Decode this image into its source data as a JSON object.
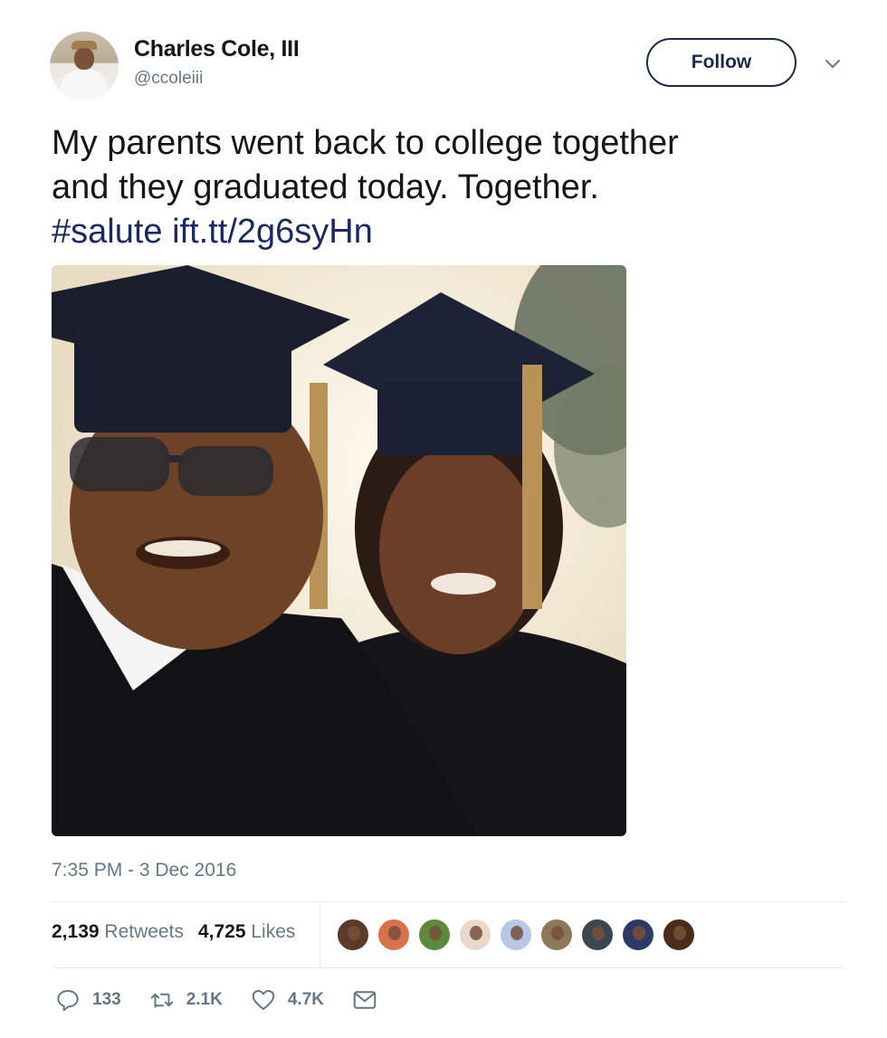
{
  "author": {
    "name": "Charles Cole, III",
    "handle": "@ccoleiii"
  },
  "follow_label": "Follow",
  "tweet": {
    "text_line1": "My parents went back to college together",
    "text_line2": "and they graduated today. Together.",
    "hashtag": "#salute",
    "link": "ift.tt/2g6syHn"
  },
  "timestamp": "7:35 PM - 3 Dec 2016",
  "stats": {
    "retweets_count": "2,139",
    "retweets_label": "Retweets",
    "likes_count": "4,725",
    "likes_label": "Likes"
  },
  "likers": [
    {
      "color": "#5b3a2a"
    },
    {
      "color": "#d9714a"
    },
    {
      "color": "#5a8a3a"
    },
    {
      "color": "#e9d8cc"
    },
    {
      "color": "#b8c7e8"
    },
    {
      "color": "#8a7a5a"
    },
    {
      "color": "#3b4650"
    },
    {
      "color": "#2e3a66"
    },
    {
      "color": "#4a2c1c"
    }
  ],
  "actions": {
    "replies": "133",
    "retweets": "2.1K",
    "likes": "4.7K"
  },
  "icons": [
    "chevron-down-icon",
    "reply-icon",
    "retweet-icon",
    "like-icon",
    "direct-message-icon"
  ]
}
